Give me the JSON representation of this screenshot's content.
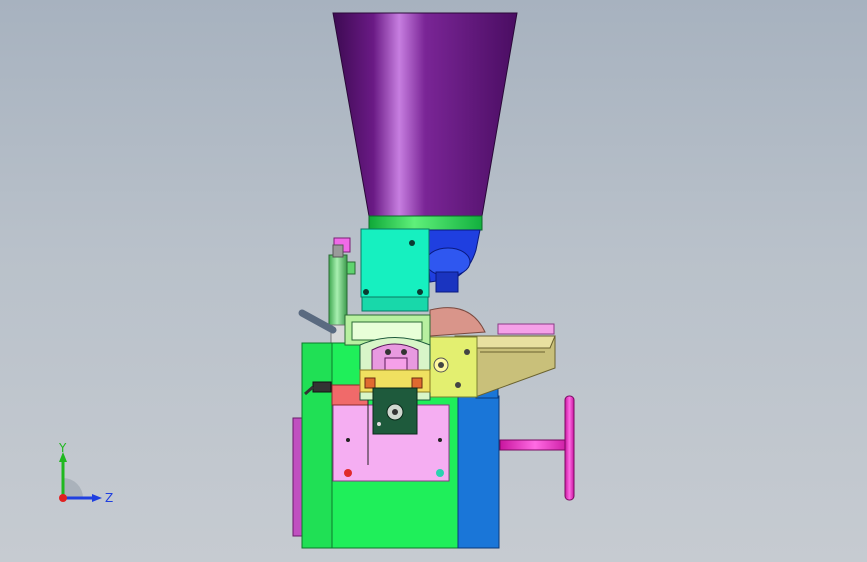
{
  "viewport": {
    "background_top": "#a7b2bf",
    "background_bottom": "#c6cbd1"
  },
  "colors": {
    "hopper": "#5b1370",
    "hopper_highlight": "#c77ee0",
    "collar": "#1ed04a",
    "motor_blue": "#1f3fe0",
    "cyan_block": "#16f0c0",
    "green_body": "#1fef5a",
    "pink_panel": "#f5aef2",
    "blue_column": "#1a76d8",
    "magenta_handle": "#ff2fd6",
    "tan_chute": "#c9c07a",
    "yellow_plate": "#e3ef70",
    "salmon_disk": "#d9958a",
    "dark_green": "#1e5a3c",
    "light_green_tube": "#7be08a",
    "red_block": "#f06a6a"
  },
  "triad": {
    "y_label": "Y",
    "z_label": "Z",
    "y_color": "#1fb81f",
    "z_color": "#1f3fe0",
    "origin_color": "#e02020"
  }
}
